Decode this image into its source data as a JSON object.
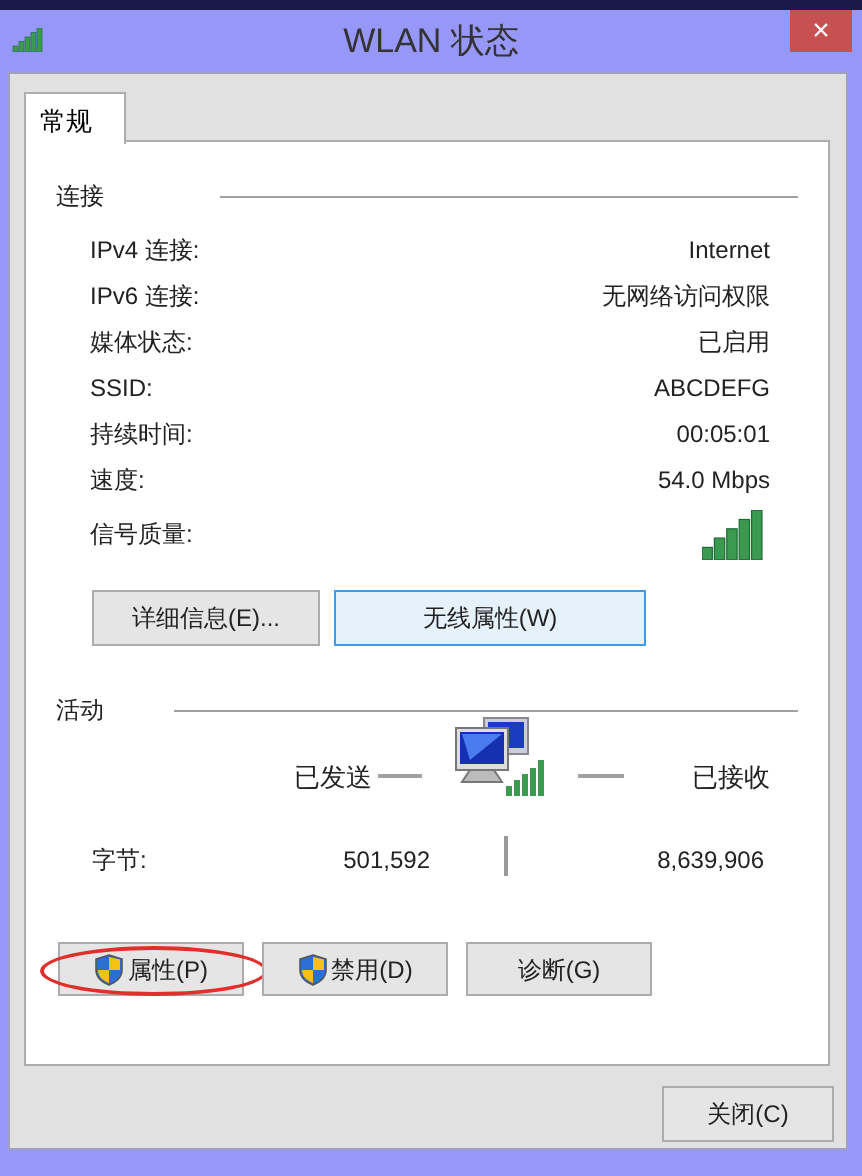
{
  "window": {
    "title": "WLAN 状态",
    "close": "×"
  },
  "tabs": [
    {
      "label": "常规",
      "selected": true
    }
  ],
  "connection": {
    "heading": "连接",
    "rows": [
      {
        "label": "IPv4 连接:",
        "value": "Internet"
      },
      {
        "label": "IPv6 连接:",
        "value": "无网络访问权限"
      },
      {
        "label": "媒体状态:",
        "value": "已启用"
      },
      {
        "label": "SSID:",
        "value": "ABCDEFG"
      },
      {
        "label": "持续时间:",
        "value": "00:05:01"
      },
      {
        "label": "速度:",
        "value": "54.0 Mbps"
      },
      {
        "label": "信号质量:",
        "kind": "signal"
      }
    ],
    "buttons": [
      {
        "label": "详细信息(E)...",
        "focused": false
      },
      {
        "label": "无线属性(W)",
        "focused": true
      }
    ]
  },
  "activity": {
    "heading": "活动",
    "sent_label": "已发送",
    "received_label": "已接收",
    "bytes_label": "字节:",
    "bytes_sent": "501,592",
    "bytes_received": "8,639,906",
    "buttons": [
      {
        "label": "属性(P)",
        "shield": true,
        "circled": true
      },
      {
        "label": "禁用(D)",
        "shield": true,
        "circled": false
      },
      {
        "label": "诊断(G)",
        "shield": false,
        "circled": false
      }
    ]
  },
  "footer_buttons": [
    "关闭(C)"
  ]
}
